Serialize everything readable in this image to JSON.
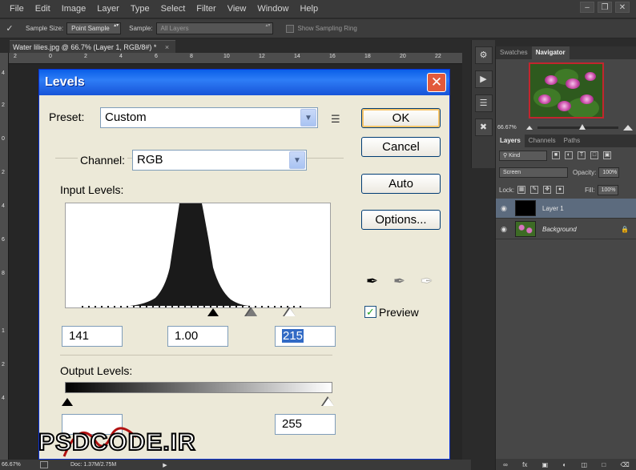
{
  "menubar": {
    "items": [
      "File",
      "Edit",
      "Image",
      "Layer",
      "Type",
      "Select",
      "Filter",
      "View",
      "Window",
      "Help"
    ]
  },
  "optionsbar": {
    "sample_size_label": "Sample Size:",
    "sample_size_value": "Point Sample",
    "sample_label": "Sample:",
    "sample_value": "All Layers",
    "show_ring_label": "Show Sampling Ring"
  },
  "document": {
    "tab_title": "Water lilies.jpg @ 66.7% (Layer 1, RGB/8#) *",
    "close_glyph": "×",
    "ruler_top": [
      "2",
      "0",
      "2",
      "4",
      "6",
      "8",
      "10",
      "12",
      "14",
      "16",
      "18",
      "20",
      "22"
    ],
    "ruler_left": [
      "4",
      "2",
      "0",
      "2",
      "4",
      "6",
      "8",
      "1",
      "2",
      "4"
    ]
  },
  "statusbar": {
    "zoom": "66.67%",
    "doc_info": "Doc: 1.37M/2.75M"
  },
  "panels": {
    "tabs_top": [
      "Swatches",
      "Navigator"
    ],
    "active_top": "Navigator",
    "navigator_zoom": "66.67%",
    "tabs_layers": [
      "Layers",
      "Channels",
      "Paths"
    ],
    "kind_label": "Kind",
    "blend_mode": "Screen",
    "opacity_label": "Opacity:",
    "opacity_value": "100%",
    "lock_label": "Lock:",
    "fill_label": "Fill:",
    "fill_value": "100%",
    "layers": [
      {
        "name": "Layer 1",
        "selected": true
      },
      {
        "name": "Background",
        "selected": false
      }
    ]
  },
  "levels": {
    "title": "Levels",
    "preset_label": "Preset:",
    "preset_value": "Custom",
    "channel_label": "Channel:",
    "channel_value": "RGB",
    "input_levels_label": "Input Levels:",
    "input_black": "141",
    "input_gamma": "1.00",
    "input_white": "215",
    "output_levels_label": "Output Levels:",
    "output_black": "",
    "output_white": "255",
    "buttons": {
      "ok": "OK",
      "cancel": "Cancel",
      "auto": "Auto",
      "options": "Options..."
    },
    "preview_label": "Preview",
    "preview_checked": true
  },
  "watermark": {
    "text": "PSDCODE.IR"
  },
  "colors": {
    "ps_dark": "#2b2b2b",
    "ps_panel": "#474747",
    "xp_title": "#0a5fe8",
    "xp_face": "#ece9d8",
    "selection": "#316ac5",
    "layer_selected": "#5c6b7e"
  }
}
